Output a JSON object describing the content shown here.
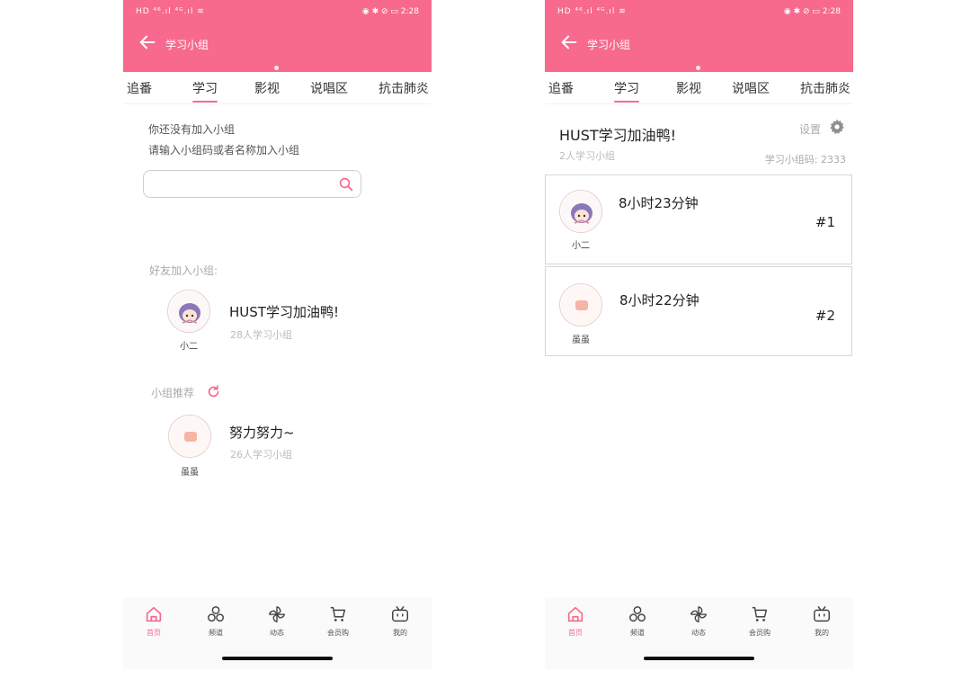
{
  "colors": {
    "accent": "#f7698d",
    "header_bg": "#f7698d"
  },
  "status_bar": {
    "carrier": "HD ⁴⁶.ıl ⁴ᴳ.ıl ≋",
    "right": "◉ ✱ ⊘ ▭ 2:28"
  },
  "tabs": [
    "追番",
    "学习",
    "影视",
    "说唱区",
    "抗击肺炎"
  ],
  "active_tab": "学习",
  "bottom_nav": [
    {
      "label": "首页",
      "icon": "home-icon",
      "active": true
    },
    {
      "label": "频道",
      "icon": "channel-icon",
      "active": false
    },
    {
      "label": "动态",
      "icon": "pinwheel-icon",
      "active": false
    },
    {
      "label": "会员购",
      "icon": "cart-icon",
      "active": false
    },
    {
      "label": "我的",
      "icon": "tv-icon",
      "active": false
    }
  ],
  "screen1": {
    "header_title": "学习小组",
    "no_group_line1": "你还没有加入小组",
    "no_group_line2": "请输入小组码或者名称加入小组",
    "search_placeholder": "",
    "friends_section_label": "好友加入小组:",
    "friend_group": {
      "avatar_name": "小二",
      "name": "HUST学习加油鸭!",
      "meta": "28人学习小组"
    },
    "recommend_section_label": "小组推荐",
    "recommended_group": {
      "avatar_name": "虽虽",
      "name": "努力努力~",
      "meta": "26人学习小组"
    }
  },
  "screen2": {
    "header_title": "学习小组",
    "group_title": "HUST学习加油鸭!",
    "member_count": "2人学习小组",
    "settings_label": "设置",
    "group_code": "学习小组码: 2333",
    "ranking": [
      {
        "avatar_name": "小二",
        "time": "8小时23分钟",
        "rank": "#1"
      },
      {
        "avatar_name": "虽虽",
        "time": "8小时22分钟",
        "rank": "#2"
      }
    ]
  }
}
